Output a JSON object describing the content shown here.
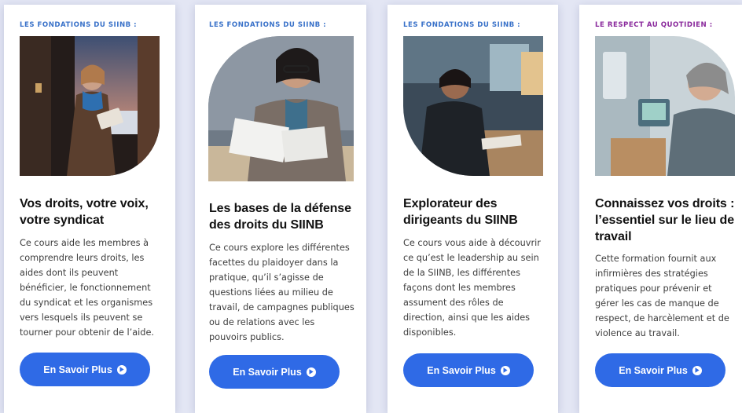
{
  "colors": {
    "accent_blue": "#2f6ae6",
    "eyebrow_blue": "#3a72c9",
    "eyebrow_purple": "#8a2a9c"
  },
  "cards": [
    {
      "eyebrow": "LES FONDATIONS DU SIINB :",
      "title": "Vos droits, votre voix, votre syndicat",
      "description": "Ce cours aide les membres à comprendre leurs droits, les aides dont ils peuvent bénéficier, le fonctionnement du syndicat et les organismes vers lesquels ils peuvent se tourner pour obtenir de l’aide.",
      "button_label": "En Savoir Plus",
      "button_icon": "play-circle-icon"
    },
    {
      "eyebrow": "LES FONDATIONS DU SIINB :",
      "title": "Les bases de la défense des droits du SIINB",
      "description": "Ce cours explore les différentes facettes du plaidoyer dans la pratique, qu’il s’agisse de questions liées au milieu de travail, de campagnes publiques ou de relations avec les pouvoirs publics.",
      "button_label": "En Savoir Plus",
      "button_icon": "play-circle-icon"
    },
    {
      "eyebrow": "LES FONDATIONS DU SIINB :",
      "title": "Explorateur des dirigeants du SIINB",
      "description": "Ce cours vous aide à découvrir ce qu’est le leadership au sein de la SIINB, les différentes façons dont les membres assument des rôles de direction, ainsi que les aides disponibles.",
      "button_label": "En Savoir Plus",
      "button_icon": "play-circle-icon"
    },
    {
      "eyebrow": "LE RESPECT AU QUOTIDIEN :",
      "title": "Connaissez vos droits : l’essentiel sur le lieu de travail",
      "description": "Cette formation fournit aux infirmières des stratégies pratiques pour prévenir et gérer les cas de manque de respect, de harcèlement et de violence au travail.",
      "button_label": "En Savoir Plus",
      "button_icon": "play-circle-icon"
    }
  ]
}
